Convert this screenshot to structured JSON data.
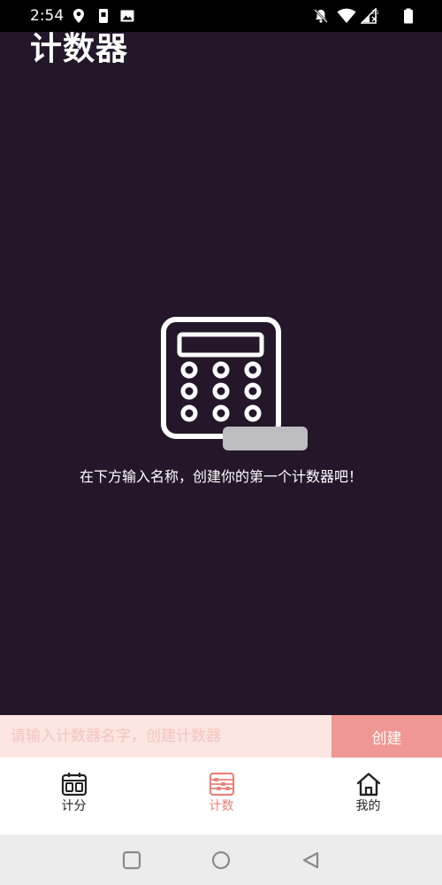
{
  "status_bar": {
    "time": "2:54",
    "icons": [
      "location-icon",
      "sim-card-icon",
      "image-icon",
      "notifications-off-icon",
      "wifi-icon",
      "signal-3g-icon",
      "battery-icon"
    ],
    "network_label": "3G"
  },
  "header": {
    "title": "计数器"
  },
  "empty_state": {
    "icon": "calculator-icon",
    "hint": "在下方输入名称，创建你的第一个计数器吧！"
  },
  "create_bar": {
    "placeholder": "请输入计数器名字，创建计数器",
    "value": "",
    "button_label": "创建"
  },
  "bottom_nav": {
    "items": [
      {
        "label": "计分",
        "icon": "scoreboard-icon",
        "active": false
      },
      {
        "label": "计数",
        "icon": "abacus-icon",
        "active": true
      },
      {
        "label": "我的",
        "icon": "home-icon",
        "active": false
      }
    ]
  },
  "system_nav": {
    "buttons": [
      "recents-button",
      "home-button",
      "back-button"
    ]
  },
  "colors": {
    "background": "#24172a",
    "accent": "#e8837a",
    "input_background": "#fde5e1",
    "button_background": "#ef9792"
  }
}
